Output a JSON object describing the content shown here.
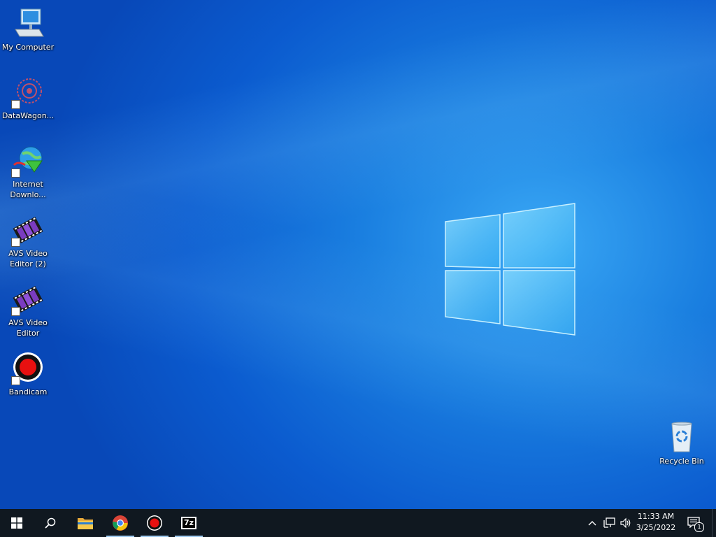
{
  "desktop": {
    "icons": [
      {
        "label": "My Computer"
      },
      {
        "label": "DataWagon..."
      },
      {
        "label_line1": "Internet",
        "label_line2": "Downlo..."
      },
      {
        "label_line1": "AVS Video",
        "label_line2": "Editor (2)"
      },
      {
        "label_line1": "AVS Video",
        "label_line2": "Editor"
      },
      {
        "label": "Bandicam"
      }
    ],
    "recycle_bin": {
      "label": "Recycle Bin"
    }
  },
  "taskbar": {
    "pinned": [
      "windows-start-icon",
      "search-icon",
      "file-explorer-icon",
      "chrome-icon",
      "bandicam-icon",
      "7zip-icon"
    ],
    "sevenzip_text": "7z",
    "clock": {
      "time": "11:33 AM",
      "date": "3/25/2022"
    },
    "notification_count": "1"
  },
  "colors": {
    "taskbar_bg": "#101820",
    "wallpaper_accent": "#1a7fe0",
    "bandicam_red": "#e81010"
  }
}
